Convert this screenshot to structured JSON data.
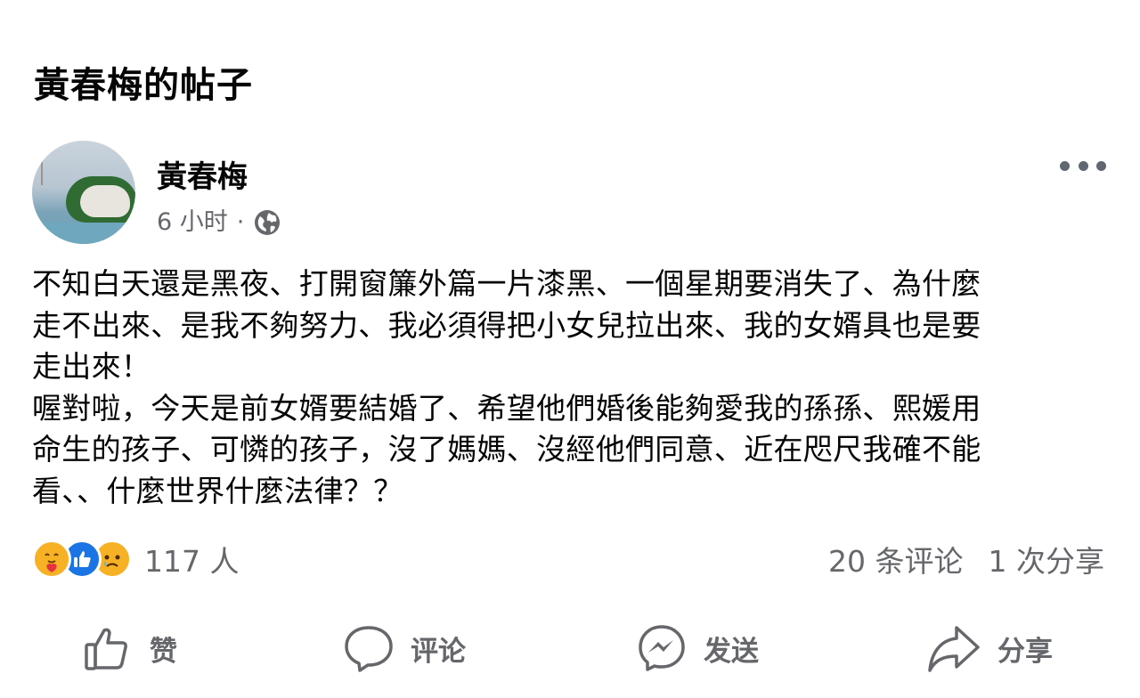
{
  "header": {
    "title": "黃春梅的帖子"
  },
  "post": {
    "author": "黃春梅",
    "time": "6 小时",
    "separator": "·",
    "privacy_icon": "globe-icon",
    "more_icon": "more-dots-icon",
    "paragraphs": [
      "不知白天還是黑夜、打開窗簾外篇一片漆黑、一個星期要消失了、為什麼\n走不出來、是我不夠努力、我必須得把小女兒拉出來、我的女婿具也是要\n走出來！",
      "喔對啦，今天是前女婿要結婚了、希望他們婚後能夠愛我的孫孫、熙媛用\n命生的孩子、可憐的孩子，沒了媽媽、沒經他們同意、近在咫尺我確不能\n看、、什麼世界什麼法律？？"
    ]
  },
  "engagement": {
    "reaction_icons": [
      "care-icon",
      "like-icon",
      "sad-icon"
    ],
    "reaction_count": "117 人",
    "comments": "20 条评论",
    "shares": "1 次分享"
  },
  "actions": {
    "like": "赞",
    "comment": "评论",
    "send": "发送",
    "share": "分享"
  },
  "colors": {
    "text": "#050505",
    "secondary": "#65676b",
    "like_blue": "#1b74e4",
    "reaction_yellow": "#f7b125"
  }
}
